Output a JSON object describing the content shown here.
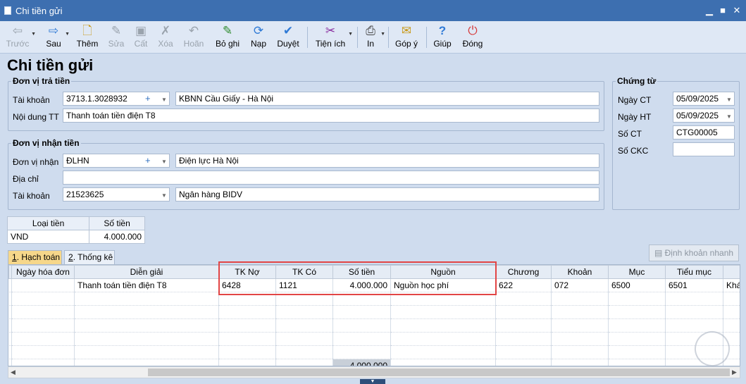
{
  "window": {
    "title": "Chi tiền gửi",
    "minimize_glyph": "▁",
    "maximize_glyph": "■",
    "close_glyph": "✕"
  },
  "toolbar": {
    "prev": {
      "label": "Trước",
      "icon": "arrow-left-icon",
      "glyph": "⇦"
    },
    "next": {
      "label": "Sau",
      "icon": "arrow-right-icon",
      "glyph": "⇨"
    },
    "add": {
      "label": "Thêm",
      "icon": "new-document-icon",
      "glyph": "🗋"
    },
    "edit": {
      "label": "Sửa",
      "icon": "edit-icon",
      "glyph": "✎"
    },
    "save": {
      "label": "Cất",
      "icon": "save-icon",
      "glyph": "▣"
    },
    "delete": {
      "label": "Xóa",
      "icon": "delete-icon",
      "glyph": "✗"
    },
    "undo": {
      "label": "Hoãn",
      "icon": "undo-icon",
      "glyph": "↶"
    },
    "unpost": {
      "label": "Bỏ ghi",
      "icon": "unpost-icon",
      "glyph": "✎"
    },
    "reload": {
      "label": "Nạp",
      "icon": "reload-icon",
      "glyph": "⟳"
    },
    "approve": {
      "label": "Duyệt",
      "icon": "check-icon",
      "glyph": "✔"
    },
    "utilities": {
      "label": "Tiện ích",
      "icon": "tools-icon",
      "glyph": "✂"
    },
    "print": {
      "label": "In",
      "icon": "printer-icon",
      "glyph": "⎙"
    },
    "feedback": {
      "label": "Góp ý",
      "icon": "feedback-icon",
      "glyph": "✉"
    },
    "help": {
      "label": "Giúp",
      "icon": "help-icon",
      "glyph": "?"
    },
    "close": {
      "label": "Đóng",
      "icon": "power-icon",
      "glyph": "⏻"
    }
  },
  "page_title": "Chi tiền gửi",
  "payer": {
    "legend": "Đơn vị trả tiền",
    "account_label": "Tài khoản",
    "account_value": "3713.1.3028932",
    "account_name": "KBNN Cầu Giấy - Hà Nội",
    "content_label": "Nội dung TT",
    "content_value": "Thanh toán tiền điện T8"
  },
  "payee": {
    "legend": "Đơn vị nhận tiền",
    "unit_label": "Đơn vị nhận",
    "unit_value": "ĐLHN",
    "unit_name": "Điện lực Hà Nội",
    "address_label": "Địa chỉ",
    "address_value": "",
    "account_label": "Tài khoản",
    "account_value": "21523625",
    "bank_name": "Ngân hàng BIDV"
  },
  "voucher": {
    "legend": "Chứng từ",
    "date_ct_label": "Ngày CT",
    "date_ct_value": "05/09/2025",
    "date_ht_label": "Ngày HT",
    "date_ht_value": "05/09/2025",
    "number_label": "Số CT",
    "number_value": "CTG00005",
    "ckc_label": "Số CKC",
    "ckc_value": ""
  },
  "currency_table": {
    "headers": [
      "Loại tiền",
      "Số tiền"
    ],
    "rows": [
      [
        "VND",
        "4.000.000"
      ]
    ]
  },
  "tabs": [
    {
      "key": "1",
      "rest": ". Hạch toán",
      "active": true
    },
    {
      "key": "2",
      "rest": ". Thống kê",
      "active": false
    }
  ],
  "quick_entry_button": {
    "label": "Định khoản nhanh",
    "icon": "calculator-icon"
  },
  "entries": {
    "headers": [
      "",
      "Ngày hóa đơn",
      "Diễn giải",
      "TK Nợ",
      "TK Có",
      "Số tiền",
      "Nguồn",
      "Chương",
      "Khoản",
      "Mục",
      "Tiểu mục",
      ""
    ],
    "rows": [
      [
        "",
        "",
        "Thanh toán tiền điện T8",
        "6428",
        "1121",
        "4.000.000",
        "Nguồn học phí",
        "622",
        "072",
        "6500",
        "6501",
        "Khá"
      ]
    ],
    "total": "4.000.000"
  }
}
